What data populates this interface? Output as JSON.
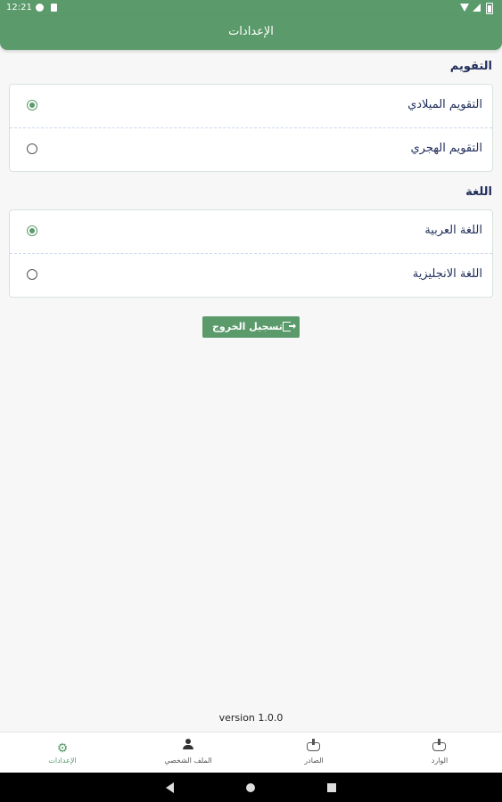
{
  "status_bar": {
    "time": "12:21",
    "icons": [
      "app-notification-icon",
      "sim-icon",
      "wifi-icon",
      "signal-icon",
      "battery-icon"
    ]
  },
  "app_bar": {
    "title": "الإعدادات"
  },
  "calendar": {
    "title": "التقويم",
    "options": [
      {
        "label": "التقويم الميلادي",
        "selected": true
      },
      {
        "label": "التقويم الهجري",
        "selected": false
      }
    ]
  },
  "language": {
    "title": "اللغة",
    "options": [
      {
        "label": "اللغة العربية",
        "selected": true
      },
      {
        "label": "اللغة الانجليزية",
        "selected": false
      }
    ]
  },
  "logout": {
    "label": "تسجيل الخروج",
    "icon": "logout-icon"
  },
  "version": "version 1.0.0",
  "bottom_nav": {
    "items": [
      {
        "label": "الإعدادات",
        "icon": "gear-icon",
        "active": true
      },
      {
        "label": "الملف الشخصي",
        "icon": "person-icon",
        "active": false
      },
      {
        "label": "الصادر",
        "icon": "outbox-icon",
        "active": false
      },
      {
        "label": "الوارد",
        "icon": "inbox-icon",
        "active": false
      }
    ]
  },
  "colors": {
    "primary": "#5b9a6b",
    "text": "#1f2d5a"
  }
}
